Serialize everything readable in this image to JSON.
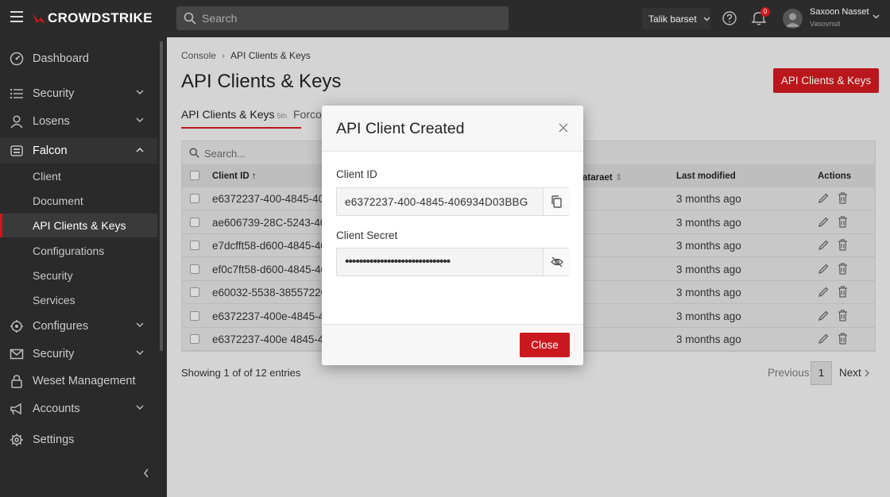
{
  "topbar": {
    "brand": "CROWDSTRIKE",
    "search_placeholder": "Search",
    "tenant": "Talik barset",
    "notification_count": "0",
    "user_name": "Saxoon Nasset",
    "user_org": "Vasovnsit"
  },
  "sidebar": {
    "items": [
      {
        "label": "Dashboard",
        "icon": "dashboard-icon"
      },
      {
        "label": "Security",
        "icon": "list-icon"
      },
      {
        "label": "Losens",
        "icon": "user-icon"
      },
      {
        "label": "Falcon",
        "icon": "falcon-icon"
      },
      {
        "label": "Configures",
        "icon": "gear-badge-icon"
      },
      {
        "label": "Security",
        "icon": "mail-icon"
      },
      {
        "label": "Weset Management",
        "icon": "lock-icon"
      },
      {
        "label": "Accounts",
        "icon": "megaphone-icon"
      },
      {
        "label": "Settings",
        "icon": "settings-icon"
      }
    ],
    "falcon_sub": [
      "Client",
      "Document",
      "API Clients & Keys",
      "Configurations",
      "Security",
      "Services"
    ],
    "active_sub": "API Clients & Keys"
  },
  "main": {
    "breadcrumb": [
      "Console",
      "API Clients & Keys"
    ],
    "title": "API Clients & Keys",
    "primary_button": "API Clients & Keys",
    "tabs": [
      {
        "label": "API Clients & Keys",
        "count": "5th"
      },
      {
        "label": "Forco"
      }
    ],
    "table": {
      "search_placeholder": "Search...",
      "columns": [
        "Client ID",
        "ataraet",
        "Last modified",
        "Actions"
      ],
      "rows": [
        {
          "client_id": "e6372237-400-4845-40",
          "modified": "3 months ago"
        },
        {
          "client_id": "ae606739-28C-5243-40",
          "modified": "3 months ago"
        },
        {
          "client_id": "e7dcfft58-d600-4845-40",
          "modified": "3 months ago"
        },
        {
          "client_id": "ef0c7ft58-d600-4845-40",
          "modified": "3 months ago"
        },
        {
          "client_id": "e60032-5538-38557220",
          "modified": "3 months ago"
        },
        {
          "client_id": "e6372237-400e-4845-42",
          "modified": "3 months ago"
        },
        {
          "client_id": "e6372237-400e 4845-418",
          "modified": "3 months ago"
        }
      ]
    },
    "showing": "Showing 1 of of 12 entries",
    "pager": {
      "prev": "Previous",
      "page": "1",
      "next": "Next"
    }
  },
  "modal": {
    "title": "API Client Created",
    "client_id_label": "Client ID",
    "client_id_value": "e6372237-400-4845-406934D03BBG",
    "secret_label": "Client Secret",
    "secret_value": "••••••••••••••••••••••••••••••",
    "close_button": "Close"
  },
  "colors": {
    "brand_red": "#c9191e",
    "sidebar_bg": "#2a2a2a",
    "topbar_bg": "#2b2b2b"
  }
}
